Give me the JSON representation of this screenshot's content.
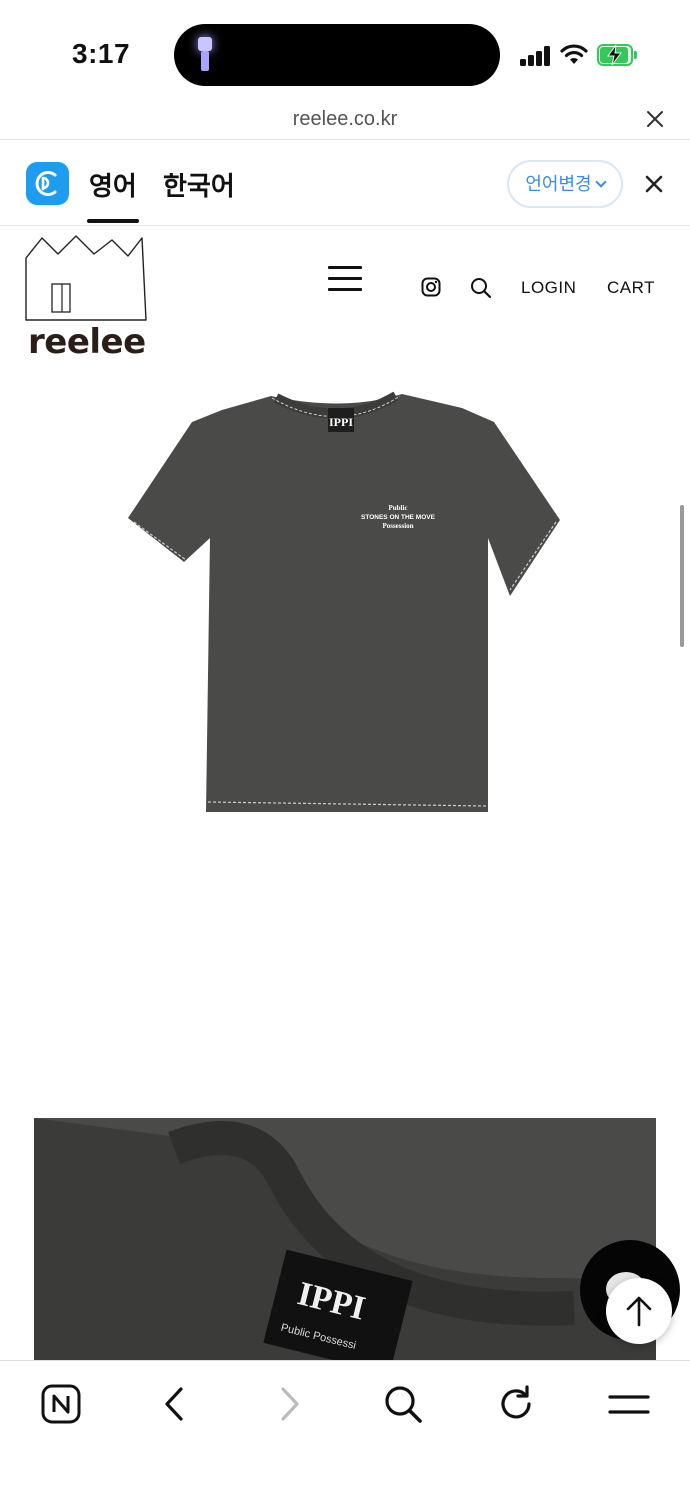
{
  "status_bar": {
    "time": "3:17"
  },
  "browser": {
    "url": "reelee.co.kr"
  },
  "translate_bar": {
    "tabs": [
      {
        "label": "영어",
        "active": true
      },
      {
        "label": "한국어",
        "active": false
      }
    ],
    "language_change_label": "언어변경"
  },
  "site_header": {
    "logo_text": "reelee",
    "login_label": "LOGIN",
    "cart_label": "CART"
  },
  "product": {
    "print_lines": [
      "Public",
      "STONES ON THE MOVE",
      "Possession"
    ],
    "tag_text": "IPPI",
    "tag_subtext": "Public Possessi"
  },
  "colors": {
    "shirt": "#4a4a48",
    "stitch": "#cfcfcf",
    "image_bg": "#f4f4f4",
    "papago_blue": "#1e9cf0",
    "link_blue": "#3a8de0",
    "battery_green": "#34c759"
  },
  "icons": {
    "browser_toolbar": [
      "naver-n-icon",
      "back-arrow-icon",
      "forward-arrow-icon",
      "search-icon",
      "refresh-icon",
      "menu-icon"
    ]
  }
}
